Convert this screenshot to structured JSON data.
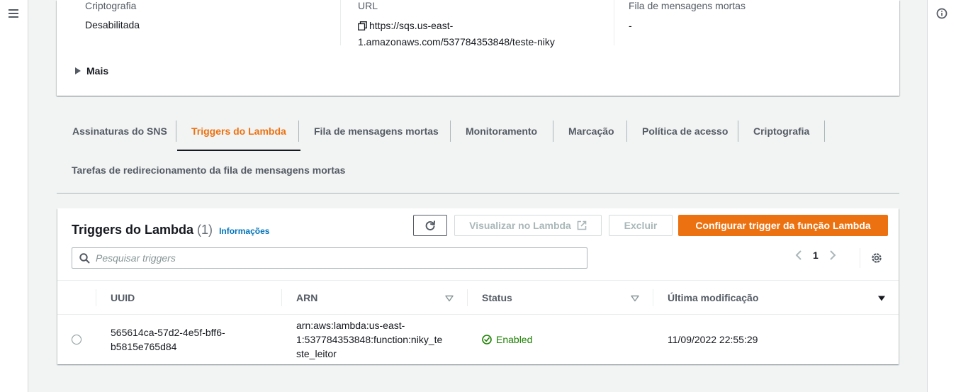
{
  "nav": {
    "menu_icon": "hamburger-icon",
    "info_icon": "info-icon"
  },
  "details": {
    "encryption_label": "Criptografia",
    "encryption_value": "Desabilitada",
    "url_label": "URL",
    "url_line1": "https://sqs.us-east-",
    "url_line2": "1.amazonaws.com/537784353848/teste-niky",
    "dlq_label": "Fila de mensagens mortas",
    "dlq_value": "-",
    "more_label": "Mais"
  },
  "tabs": {
    "items": [
      "Assinaturas do SNS",
      "Triggers do Lambda",
      "Fila de mensagens mortas",
      "Monitoramento",
      "Marcação",
      "Política de acesso",
      "Criptografia"
    ],
    "active": "Triggers do Lambda",
    "second_row": "Tarefas de redirecionamento da fila de mensagens mortas"
  },
  "triggers": {
    "title": "Triggers do Lambda",
    "count": "(1)",
    "info_link": "Informações",
    "buttons": {
      "refresh_icon": "refresh-icon",
      "view": "Visualizar no Lambda",
      "delete": "Excluir",
      "configure": "Configurar trigger da função Lambda"
    },
    "search_placeholder": "Pesquisar triggers",
    "page": "1",
    "columns": [
      "UUID",
      "ARN",
      "Status",
      "Última modificação"
    ],
    "rows": [
      {
        "uuid_line1": "565614ca-57d2-4e5f-bff6-",
        "uuid_line2": "b5815e765d84",
        "arn_line1": "arn:aws:lambda:us-east-",
        "arn_line2": "1:537784353848:function:niky_te",
        "arn_line3": "ste_leitor",
        "status": "Enabled",
        "modified": "11/09/2022 22:55:29"
      }
    ]
  },
  "colors": {
    "accent": "#ec7211",
    "link": "#0073bb",
    "success": "#1d8102"
  }
}
